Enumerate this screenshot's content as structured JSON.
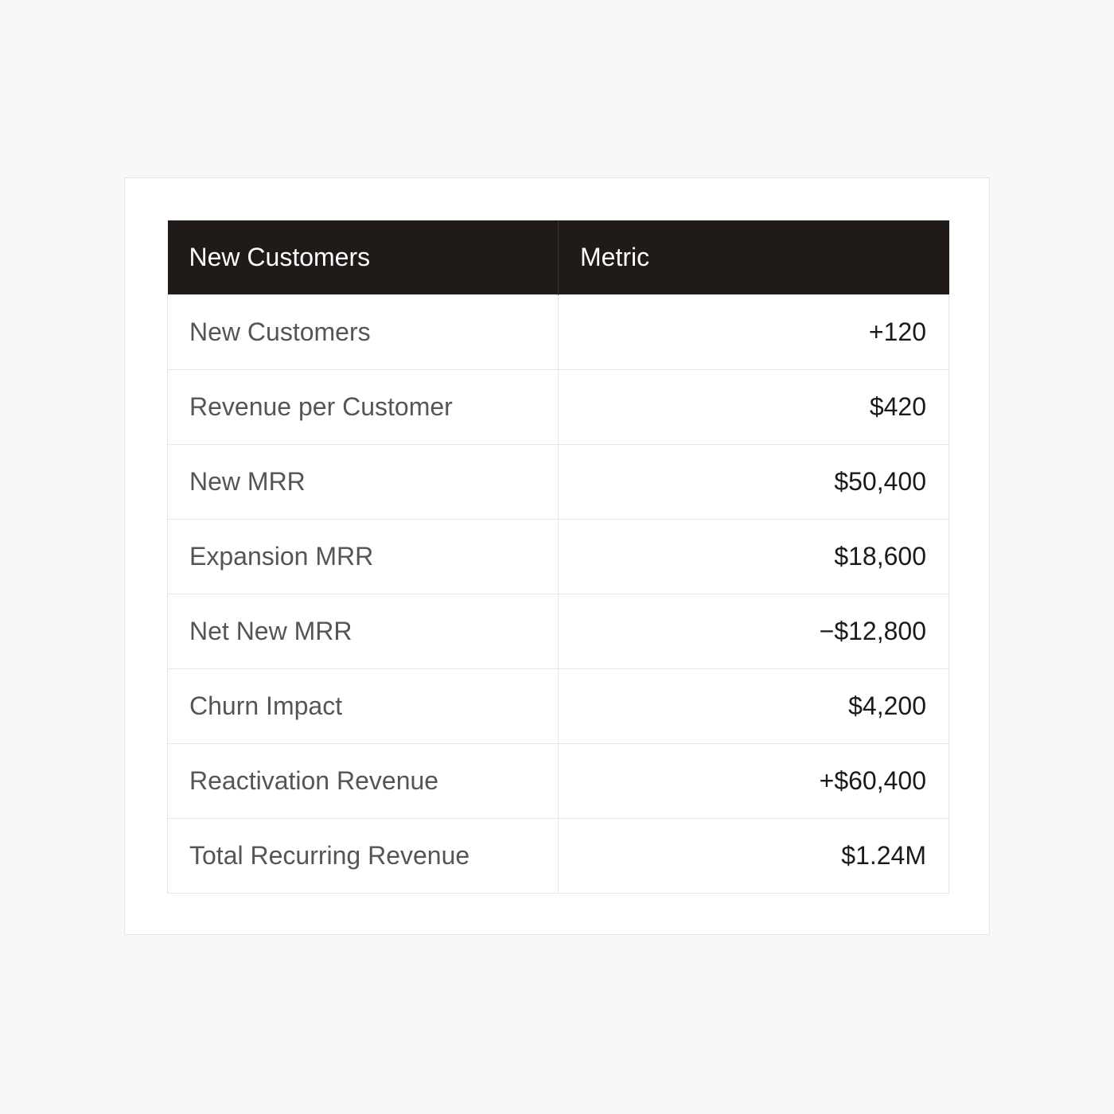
{
  "table": {
    "headers": [
      "New Customers",
      "Metric"
    ],
    "rows": [
      {
        "label": "New Customers",
        "value": "+120"
      },
      {
        "label": "Revenue per Customer",
        "value": "$420"
      },
      {
        "label": "New MRR",
        "value": "$50,400"
      },
      {
        "label": "Expansion MRR",
        "value": "$18,600"
      },
      {
        "label": "Net New MRR",
        "value": "−$12,800"
      },
      {
        "label": "Churn Impact",
        "value": "$4,200"
      },
      {
        "label": "Reactivation Revenue",
        "value": "+$60,400"
      },
      {
        "label": "Total Recurring Revenue",
        "value": "$1.24M"
      }
    ]
  },
  "colors": {
    "header_background": "#201a19",
    "header_text": "#ffffff",
    "page_background": "#f9f8f6",
    "card_background": "#ffffff",
    "label_text": "#555555",
    "value_text": "#1a1a1a",
    "border": "#e6e6e6"
  }
}
